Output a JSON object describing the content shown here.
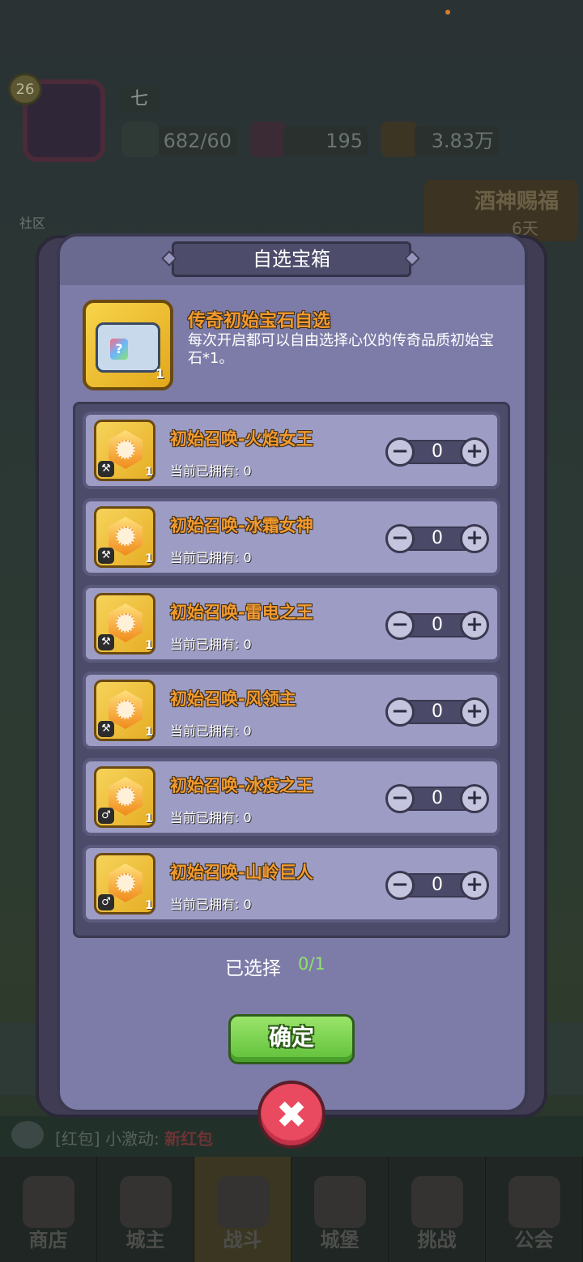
{
  "background": {
    "player_level": "26",
    "player_name": "七",
    "stamina": "682/60",
    "gems": "195",
    "gold": "3.83万",
    "community_label": "社区",
    "event_title": "酒神赐福",
    "event_days": "6天",
    "chat_prefix": "[红包] 小激动: ",
    "chat_new": "新红包",
    "nav": [
      "商店",
      "城主",
      "战斗",
      "城堡",
      "挑战",
      "公会"
    ]
  },
  "modal": {
    "title": "自选宝箱",
    "chest": {
      "name": "传奇初始宝石自选",
      "description": "每次开启都可以自由选择心仪的传奇品质初始宝石*1。",
      "count": "1"
    },
    "items": [
      {
        "name": "初始召唤-火焰女王",
        "owned": "当前已拥有: 0",
        "value": "0",
        "count": "1",
        "icon": "pickaxe-icon"
      },
      {
        "name": "初始召唤-冰霜女神",
        "owned": "当前已拥有: 0",
        "value": "0",
        "count": "1",
        "icon": "pickaxe-icon"
      },
      {
        "name": "初始召唤-雷电之王",
        "owned": "当前已拥有: 0",
        "value": "0",
        "count": "1",
        "icon": "pickaxe-icon"
      },
      {
        "name": "初始召唤-风领主",
        "owned": "当前已拥有: 0",
        "value": "0",
        "count": "1",
        "icon": "pickaxe-icon"
      },
      {
        "name": "初始召唤-冰疫之王",
        "owned": "当前已拥有: 0",
        "value": "0",
        "count": "1",
        "icon": "ring-icon"
      },
      {
        "name": "初始召唤-山岭巨人",
        "owned": "当前已拥有: 0",
        "value": "0",
        "count": "1",
        "icon": "ring-icon"
      }
    ],
    "selected_label": "已选择",
    "selected_value": "0/1",
    "confirm_label": "确定"
  },
  "colors": {
    "modal_bg": "#7d7ca9",
    "item_name": "#f29a2e",
    "confirm": "#6fcf44",
    "close": "#e94a60",
    "selected_value": "#8ee36a"
  }
}
